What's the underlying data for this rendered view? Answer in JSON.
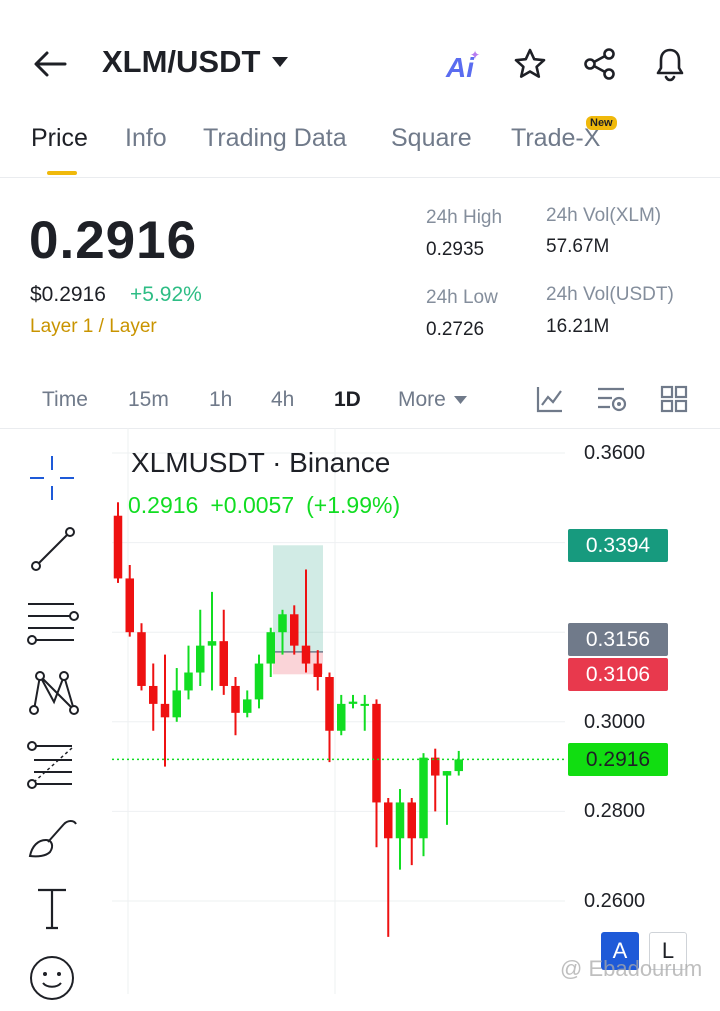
{
  "header": {
    "pair": "XLM/USDT",
    "ai_label": "Ai"
  },
  "tabs": [
    {
      "label": "Price",
      "active": true
    },
    {
      "label": "Info"
    },
    {
      "label": "Trading Data"
    },
    {
      "label": "Square"
    },
    {
      "label": "Trade-X",
      "badge": "New"
    }
  ],
  "ticker": {
    "last_price": "0.2916",
    "usd_price": "$0.2916",
    "change_pct": "+5.92%",
    "tags": "Layer 1 / Layer",
    "high_label": "24h High",
    "high": "0.2935",
    "low_label": "24h Low",
    "low": "0.2726",
    "vol_base_label": "24h Vol(XLM)",
    "vol_base": "57.67M",
    "vol_quote_label": "24h Vol(USDT)",
    "vol_quote": "16.21M"
  },
  "timeframes": [
    {
      "label": "Time"
    },
    {
      "label": "15m"
    },
    {
      "label": "1h"
    },
    {
      "label": "4h"
    },
    {
      "label": "1D",
      "active": true
    },
    {
      "label": "More"
    }
  ],
  "chart": {
    "title": "XLMUSDT · Binance",
    "last": "0.2916",
    "change": "+0.0057",
    "change_pct": "(+1.99%)",
    "axis_labels": [
      "0.3600",
      "0.3000",
      "0.2800",
      "0.2600"
    ],
    "price_tags": [
      {
        "value": "0.3394",
        "color": "#179a7e"
      },
      {
        "value": "0.3156",
        "color": "#707a8a"
      },
      {
        "value": "0.3106",
        "color": "#e8394d"
      },
      {
        "value": "0.2916",
        "color": "#11dd11"
      }
    ],
    "mode_buttons": [
      "A",
      "L"
    ],
    "watermark": "@ Ebadourum"
  },
  "colors": {
    "up": "#11dd22",
    "down": "#ee1111",
    "accent": "#f0b90b",
    "positive_text": "#2ebd85"
  },
  "chart_data": {
    "type": "candlestick",
    "ylim": [
      0.252,
      0.362
    ],
    "last_price": 0.2916,
    "candles": [
      {
        "o": 0.346,
        "h": 0.349,
        "l": 0.331,
        "c": 0.332
      },
      {
        "o": 0.332,
        "h": 0.335,
        "l": 0.319,
        "c": 0.32
      },
      {
        "o": 0.32,
        "h": 0.322,
        "l": 0.307,
        "c": 0.308
      },
      {
        "o": 0.308,
        "h": 0.313,
        "l": 0.298,
        "c": 0.304
      },
      {
        "o": 0.304,
        "h": 0.315,
        "l": 0.29,
        "c": 0.301
      },
      {
        "o": 0.301,
        "h": 0.312,
        "l": 0.3,
        "c": 0.307
      },
      {
        "o": 0.307,
        "h": 0.317,
        "l": 0.305,
        "c": 0.311
      },
      {
        "o": 0.311,
        "h": 0.325,
        "l": 0.308,
        "c": 0.317
      },
      {
        "o": 0.317,
        "h": 0.329,
        "l": 0.307,
        "c": 0.318
      },
      {
        "o": 0.318,
        "h": 0.325,
        "l": 0.306,
        "c": 0.308
      },
      {
        "o": 0.308,
        "h": 0.31,
        "l": 0.297,
        "c": 0.302
      },
      {
        "o": 0.302,
        "h": 0.307,
        "l": 0.301,
        "c": 0.305
      },
      {
        "o": 0.305,
        "h": 0.315,
        "l": 0.303,
        "c": 0.313
      },
      {
        "o": 0.313,
        "h": 0.321,
        "l": 0.31,
        "c": 0.32
      },
      {
        "o": 0.32,
        "h": 0.325,
        "l": 0.315,
        "c": 0.324
      },
      {
        "o": 0.324,
        "h": 0.326,
        "l": 0.315,
        "c": 0.317
      },
      {
        "o": 0.317,
        "h": 0.334,
        "l": 0.311,
        "c": 0.313
      },
      {
        "o": 0.313,
        "h": 0.316,
        "l": 0.307,
        "c": 0.31
      },
      {
        "o": 0.31,
        "h": 0.311,
        "l": 0.291,
        "c": 0.298
      },
      {
        "o": 0.298,
        "h": 0.306,
        "l": 0.297,
        "c": 0.304
      },
      {
        "o": 0.304,
        "h": 0.306,
        "l": 0.303,
        "c": 0.3045
      },
      {
        "o": 0.304,
        "h": 0.306,
        "l": 0.298,
        "c": 0.304
      },
      {
        "o": 0.304,
        "h": 0.305,
        "l": 0.272,
        "c": 0.282
      },
      {
        "o": 0.282,
        "h": 0.283,
        "l": 0.252,
        "c": 0.274
      },
      {
        "o": 0.274,
        "h": 0.285,
        "l": 0.267,
        "c": 0.282
      },
      {
        "o": 0.282,
        "h": 0.283,
        "l": 0.268,
        "c": 0.274
      },
      {
        "o": 0.274,
        "h": 0.293,
        "l": 0.27,
        "c": 0.292
      },
      {
        "o": 0.292,
        "h": 0.294,
        "l": 0.28,
        "c": 0.288
      },
      {
        "o": 0.288,
        "h": 0.289,
        "l": 0.277,
        "c": 0.289
      },
      {
        "o": 0.289,
        "h": 0.2935,
        "l": 0.288,
        "c": 0.2916
      }
    ]
  }
}
